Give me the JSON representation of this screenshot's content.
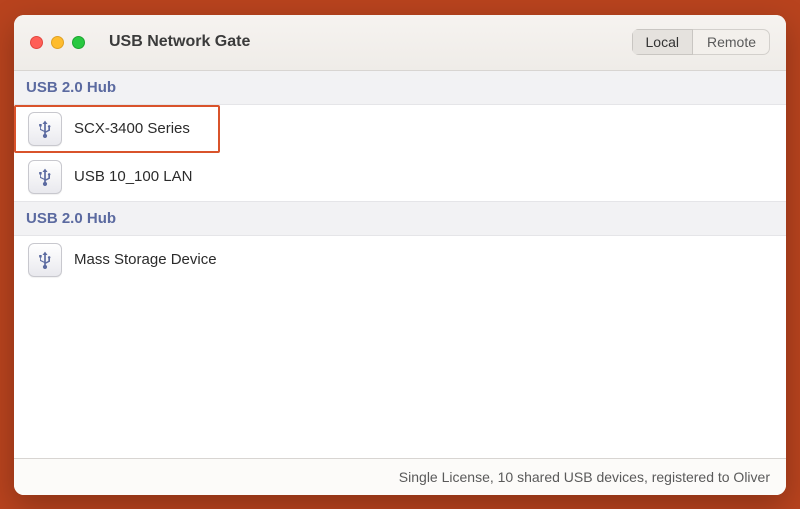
{
  "window": {
    "title": "USB Network Gate"
  },
  "tabs": {
    "local": "Local",
    "remote": "Remote",
    "active": "local"
  },
  "sections": [
    {
      "header": "USB 2.0 Hub",
      "devices": [
        {
          "name": "SCX-3400 Series",
          "highlighted": true
        },
        {
          "name": "USB 10_100 LAN",
          "highlighted": false
        }
      ]
    },
    {
      "header": "USB 2.0 Hub",
      "devices": [
        {
          "name": "Mass Storage Device",
          "highlighted": false
        }
      ]
    }
  ],
  "footer": {
    "text": "Single License, 10 shared USB devices, registered to Oliver"
  }
}
